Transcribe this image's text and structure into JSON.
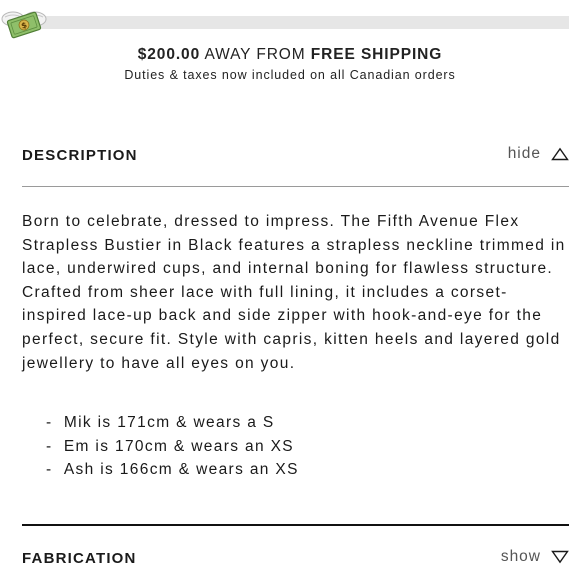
{
  "promo": {
    "icon": "money-wings-icon",
    "progress_fraction": 0.0,
    "amount": "$200.00",
    "away_text": "AWAY FROM",
    "free_shipping": "FREE SHIPPING",
    "subtext": "Duties & taxes now included on all Canadian orders"
  },
  "description_section": {
    "title": "DESCRIPTION",
    "toggle_label": "hide",
    "toggle_icon": "chevron-up-icon",
    "body": "Born to celebrate, dressed to impress. The Fifth Avenue Flex Strapless Bustier in Black features a strapless neckline trimmed in lace, underwired cups, and internal boning for flawless structure. Crafted from sheer lace with full lining, it includes a corset-inspired lace-up back and side zipper with hook-and-eye for the perfect, secure fit. Style with capris, kitten heels and layered gold jewellery to have all eyes on you.",
    "models": [
      "Mik is 171cm & wears a S",
      "Em is 170cm & wears an XS",
      "Ash is 166cm & wears an XS"
    ]
  },
  "fabrication_section": {
    "title": "FABRICATION",
    "toggle_label": "show",
    "toggle_icon": "chevron-down-icon"
  },
  "colors": {
    "bar": "#111111",
    "text": "#1a1a1a",
    "muted": "#555555"
  }
}
